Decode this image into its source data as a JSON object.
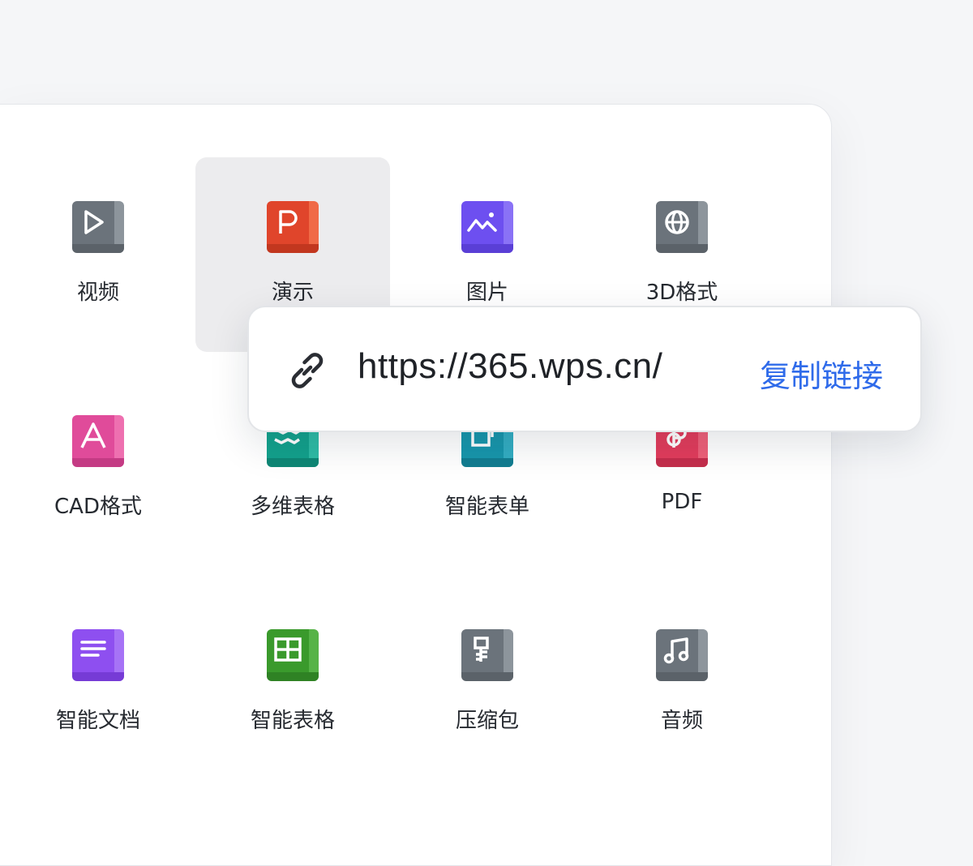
{
  "colors": {
    "background": "#f5f6f8",
    "panel": "#ffffff",
    "hover_cell": "#ececee",
    "link_accent": "#2f6bea"
  },
  "file_types": [
    {
      "label": "视频",
      "icon": "video-play-icon",
      "color": "#6b737b",
      "side": "#8d959c",
      "foot": "#5b6269"
    },
    {
      "label": "演示",
      "icon": "presentation-p-icon",
      "color": "#e0452b",
      "side": "#f06a47",
      "foot": "#c2371f",
      "highlighted": true
    },
    {
      "label": "图片",
      "icon": "image-mountain-icon",
      "color": "#6d4ff0",
      "side": "#8a72f6",
      "foot": "#5a3fd6"
    },
    {
      "label": "3D格式",
      "icon": "globe-icon",
      "color": "#6b737b",
      "side": "#8d959c",
      "foot": "#5b6269"
    },
    {
      "label": "CAD格式",
      "icon": "cad-letter-a-icon",
      "color": "#e04b9a",
      "side": "#ee70b0",
      "foot": "#c43b84"
    },
    {
      "label": "多维表格",
      "icon": "multidimensional-table-icon",
      "color": "#13a18c",
      "side": "#2fbba5",
      "foot": "#0e8775"
    },
    {
      "label": "智能表单",
      "icon": "smart-form-icon",
      "color": "#1896ac",
      "side": "#33adc2",
      "foot": "#127d90"
    },
    {
      "label": "PDF",
      "icon": "pdf-icon",
      "color": "#e23c5c",
      "side": "#ef6079",
      "foot": "#c42e4c"
    },
    {
      "label": "智能文档",
      "icon": "smart-document-icon",
      "color": "#8e4ff0",
      "side": "#a673f6",
      "foot": "#763bd6"
    },
    {
      "label": "智能表格",
      "icon": "smart-spreadsheet-icon",
      "color": "#3a9a2c",
      "side": "#56b347",
      "foot": "#2f8224"
    },
    {
      "label": "压缩包",
      "icon": "zip-archive-icon",
      "color": "#6b737b",
      "side": "#8d959c",
      "foot": "#5b6269"
    },
    {
      "label": "音频",
      "icon": "music-note-icon",
      "color": "#6b737b",
      "side": "#8d959c",
      "foot": "#5b6269"
    }
  ],
  "share_popup": {
    "icon": "link-icon",
    "url": "https://365.wps.cn/",
    "copy_label": "复制链接"
  }
}
